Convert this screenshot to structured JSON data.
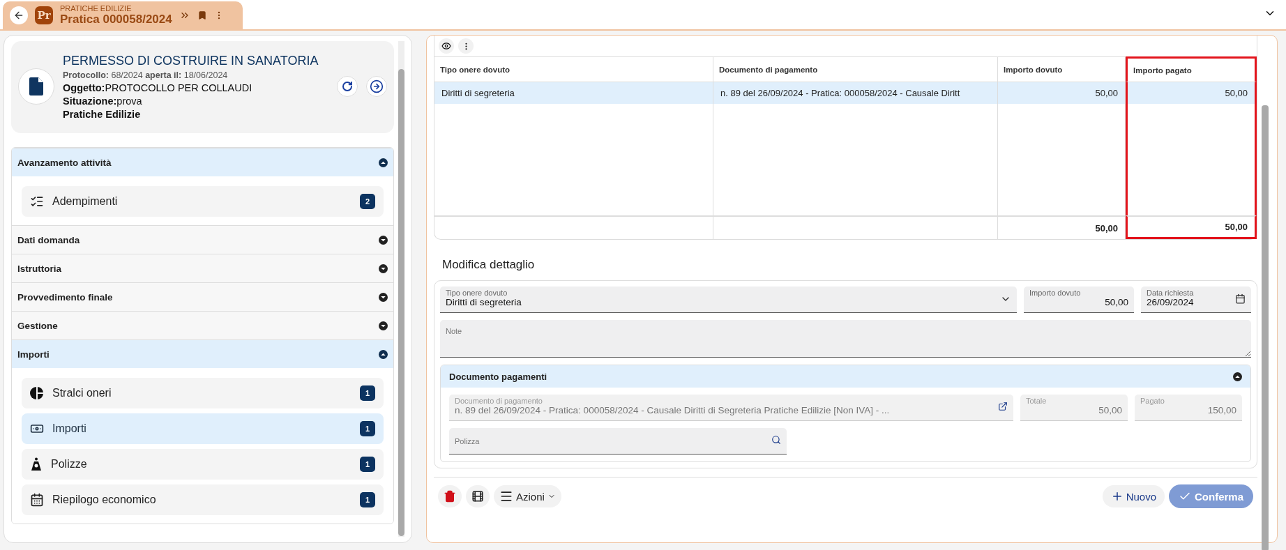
{
  "header_tab": {
    "category": "PRATICHE EDILIZIE",
    "title": "Pratica 000058/2024",
    "logo": "Pr"
  },
  "summary": {
    "title": "PERMESSO DI COSTRUIRE IN SANATORIA",
    "protocol_label": "Protocollo:",
    "protocol": "68/2024",
    "opened_label": "aperta il:",
    "opened": "18/06/2024",
    "object_label": "Oggetto:",
    "object": "PROTOCOLLO PER COLLAUDI",
    "status_label": "Situazione:",
    "status": "prova",
    "area": "Pratiche Edilizie"
  },
  "sections": [
    {
      "title": "Avanzamento attività",
      "expanded": true,
      "items": [
        {
          "kind": "checklist",
          "label": "Adempimenti",
          "count": "2",
          "selected": false
        }
      ]
    },
    {
      "title": "Dati domanda",
      "expanded": false
    },
    {
      "title": "Istruttoria",
      "expanded": false
    },
    {
      "title": "Provvedimento finale",
      "expanded": false
    },
    {
      "title": "Gestione",
      "expanded": false
    },
    {
      "title": "Importi",
      "expanded": true,
      "items": [
        {
          "kind": "pie",
          "label": "Stralci oneri",
          "count": "1",
          "selected": false
        },
        {
          "kind": "money",
          "label": "Importi",
          "count": "1",
          "selected": true
        },
        {
          "kind": "bag",
          "label": "Polizze",
          "count": "1",
          "selected": false
        },
        {
          "kind": "calendar",
          "label": "Riepilogo economico",
          "count": "1",
          "selected": false
        }
      ]
    }
  ],
  "table": {
    "columns": [
      {
        "label": "Tipo onere dovuto",
        "highlighted": false
      },
      {
        "label": "Documento di pagamento",
        "highlighted": false
      },
      {
        "label": "Importo dovuto",
        "highlighted": false
      },
      {
        "label": "Importo pagato",
        "highlighted": true
      }
    ],
    "rows": [
      {
        "selected": true,
        "cells": [
          "Diritti di segreteria",
          "n. 89 del 26/09/2024 - Pratica: 000058/2024 - Causale Diritt",
          "50,00",
          "50,00"
        ]
      }
    ],
    "totals": {
      "importo_dovuto": "50,00",
      "importo_pagato": "50,00"
    }
  },
  "detail": {
    "title": "Modifica dettaglio",
    "tipo": {
      "label": "Tipo onere dovuto",
      "value": "Diritti di segreteria"
    },
    "importo": {
      "label": "Importo dovuto",
      "value": "50,00"
    },
    "data": {
      "label": "Data richiesta",
      "value": "26/09/2024"
    },
    "note": {
      "placeholder": "Note"
    },
    "documents": {
      "title": "Documento pagamenti",
      "expanded": true,
      "documento": {
        "label": "Documento di pagamento",
        "value": "n. 89 del 26/09/2024 - Pratica: 000058/2024 - Causale Diritti di Segreteria Pratiche Edilizie [Non IVA] - ..."
      },
      "totale": {
        "label": "Totale",
        "value": "50,00"
      },
      "pagato": {
        "label": "Pagato",
        "value": "150,00"
      },
      "polizza": {
        "placeholder": "Polizza"
      }
    }
  },
  "actions": {
    "menu": "Azioni",
    "new": "Nuovo",
    "confirm": "Conferma",
    "confirm_disabled": true
  }
}
